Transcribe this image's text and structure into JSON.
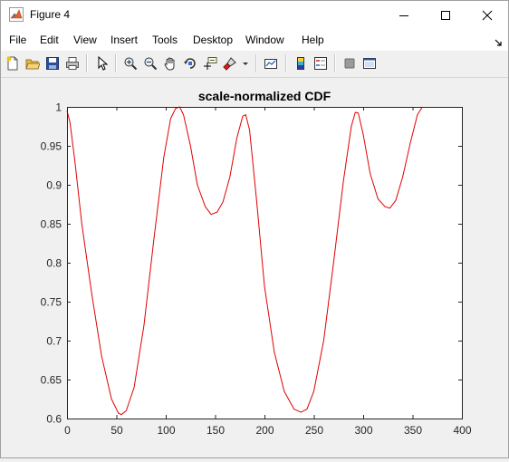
{
  "window": {
    "title": "Figure 4"
  },
  "menu": [
    "File",
    "Edit",
    "View",
    "Insert",
    "Tools",
    "Desktop",
    "Window",
    "Help"
  ],
  "toolbar": {
    "icons": [
      "new-figure-icon",
      "open-file-icon",
      "save-icon",
      "print-icon",
      "edit-plot-arrow-icon",
      "zoom-in-icon",
      "zoom-out-icon",
      "pan-hand-icon",
      "rotate-3d-icon",
      "data-cursor-icon",
      "brush-icon",
      "brush-dropdown-icon",
      "link-plot-icon",
      "insert-colorbar-icon",
      "insert-legend-icon",
      "hide-plot-tools-icon",
      "show-plot-tools-icon"
    ]
  },
  "chart_data": {
    "type": "line",
    "title": "scale-normalized CDF",
    "xlabel": "",
    "ylabel": "",
    "xlim": [
      0,
      400
    ],
    "ylim": [
      0.6,
      1.0
    ],
    "xticks": [
      "0",
      "50",
      "100",
      "150",
      "200",
      "250",
      "300",
      "350",
      "400"
    ],
    "yticks": [
      "0.6",
      "0.65",
      "0.7",
      "0.75",
      "0.8",
      "0.85",
      "0.9",
      "0.95",
      "1"
    ],
    "grid": false,
    "series": [
      {
        "color": "#e00000",
        "x": [
          0,
          3,
          8,
          15,
          25,
          35,
          45,
          52,
          55,
          60,
          68,
          78,
          88,
          98,
          105,
          110,
          114,
          118,
          125,
          132,
          140,
          146,
          152,
          158,
          165,
          172,
          178,
          181,
          185,
          192,
          200,
          210,
          220,
          230,
          237,
          243,
          250,
          260,
          270,
          280,
          288,
          292,
          295,
          300,
          307,
          315,
          322,
          327,
          333,
          340,
          348,
          355,
          360
        ],
        "y": [
          0.995,
          0.98,
          0.93,
          0.85,
          0.76,
          0.68,
          0.625,
          0.607,
          0.605,
          0.61,
          0.64,
          0.72,
          0.83,
          0.935,
          0.985,
          0.998,
          1.0,
          0.99,
          0.95,
          0.9,
          0.872,
          0.862,
          0.865,
          0.878,
          0.91,
          0.96,
          0.988,
          0.99,
          0.97,
          0.88,
          0.77,
          0.685,
          0.635,
          0.612,
          0.608,
          0.612,
          0.635,
          0.7,
          0.8,
          0.905,
          0.975,
          0.993,
          0.992,
          0.965,
          0.915,
          0.882,
          0.872,
          0.87,
          0.88,
          0.91,
          0.955,
          0.99,
          1.0
        ]
      }
    ]
  }
}
